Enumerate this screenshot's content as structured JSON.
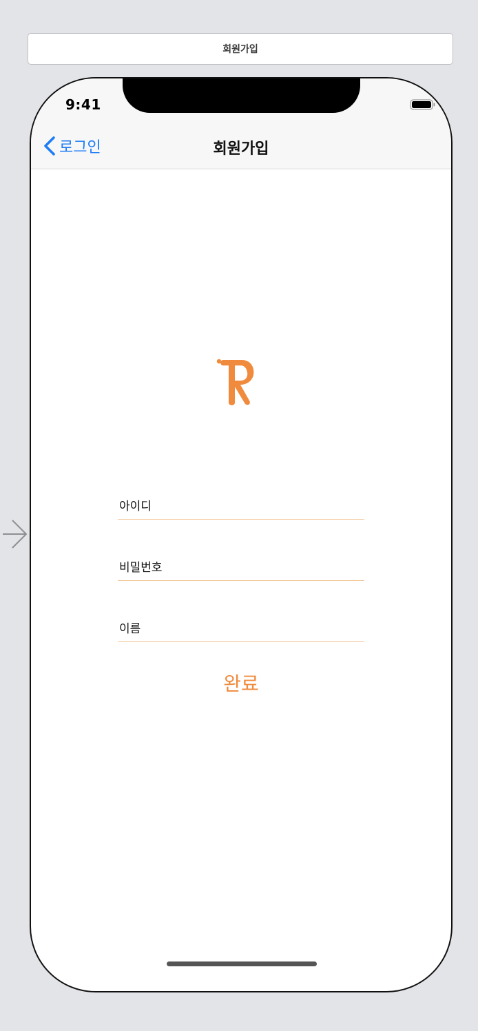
{
  "scene": {
    "title": "회원가입"
  },
  "status_bar": {
    "time": "9:41"
  },
  "nav": {
    "back_label": "로그인",
    "title": "회원가입"
  },
  "logo": {
    "letter": "R"
  },
  "form": {
    "id_placeholder": "아이디",
    "password_placeholder": "비밀번호",
    "name_placeholder": "이름",
    "submit_label": "완료"
  },
  "colors": {
    "accent": "#f08a3c",
    "link_blue": "#1e7cf5",
    "underline": "#f0c898",
    "canvas_bg": "#e3e4e8"
  },
  "icons": [
    "segue-arrow-icon",
    "chevron-left-icon",
    "battery-icon",
    "r-logo-icon"
  ]
}
